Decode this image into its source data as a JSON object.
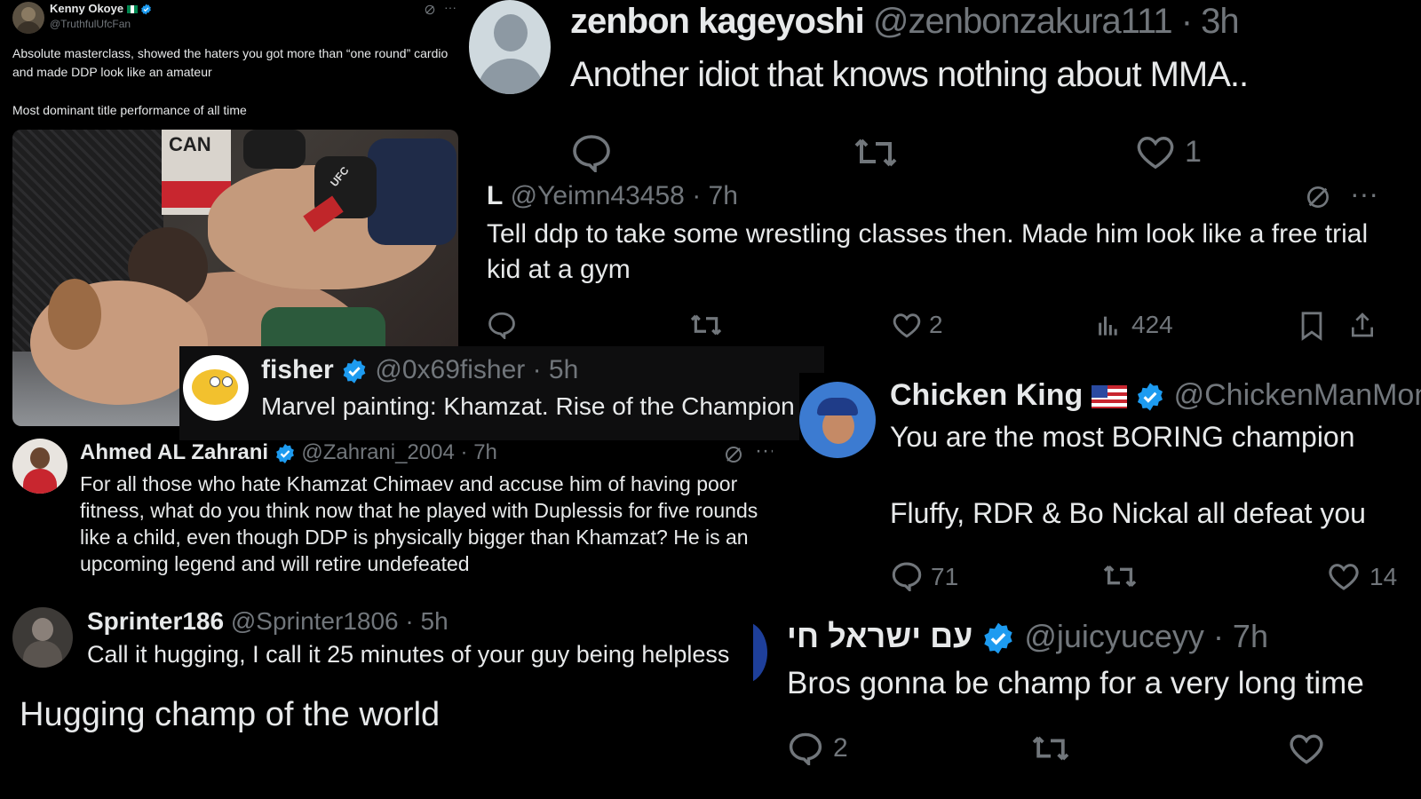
{
  "p1": {
    "name": "Kenny Okoye",
    "handle": "@TruthfulUfcFan",
    "text1": "Absolute masterclass, showed the haters you got more than “one round” cardio and made DDP look like an amateur",
    "text2": "Most dominant title performance of all time",
    "photo_text": "CAN",
    "glove_text": "UFC"
  },
  "p2": {
    "name": "zenbon kageyoshi",
    "handle": "@zenbonzakura111",
    "time": "· 3h",
    "text": "Another idiot that knows nothing about MMA..",
    "likes": "1"
  },
  "p3": {
    "name": "L",
    "handle": "@Yeimn43458",
    "time": "· 7h",
    "text": "Tell ddp to take some wrestling classes then. Made him look like a free trial kid at a gym",
    "likes": "2",
    "views": "424"
  },
  "p4": {
    "name": "fisher",
    "handle": "@0x69fisher",
    "time": "· 5h",
    "text": "Marvel painting: Khamzat. Rise of the Champion"
  },
  "p5": {
    "name": "Chicken King",
    "handle": "@ChickenManMon",
    "text1": "You are the most BORING champion",
    "text2": "Fluffy, RDR & Bo Nickal all defeat you",
    "replies": "71",
    "likes": "14"
  },
  "p6": {
    "name": "Ahmed AL Zahrani",
    "handle": "@Zahrani_2004",
    "time": "· 7h",
    "text": "For all those who hate Khamzat Chimaev and accuse him of having poor fitness, what do you think now that he played with Duplessis for five rounds like a child, even though DDP is physically bigger than Khamzat? He is an upcoming legend and will retire undefeated"
  },
  "p7": {
    "name": "Sprinter186",
    "handle": "@Sprinter1806",
    "time": "· 5h",
    "text": "Call it hugging, I call it 25 minutes of your guy being helpless",
    "caption": "Hugging champ of the world"
  },
  "p8": {
    "name": "עם ישראל חי",
    "handle": "@juicyuceyy",
    "time": "· 7h",
    "text": "Bros gonna be champ for a very long time",
    "replies": "2"
  },
  "colors": {
    "verified": "#1d9bf0",
    "text": "#e7e9ea",
    "muted": "#71767b"
  }
}
